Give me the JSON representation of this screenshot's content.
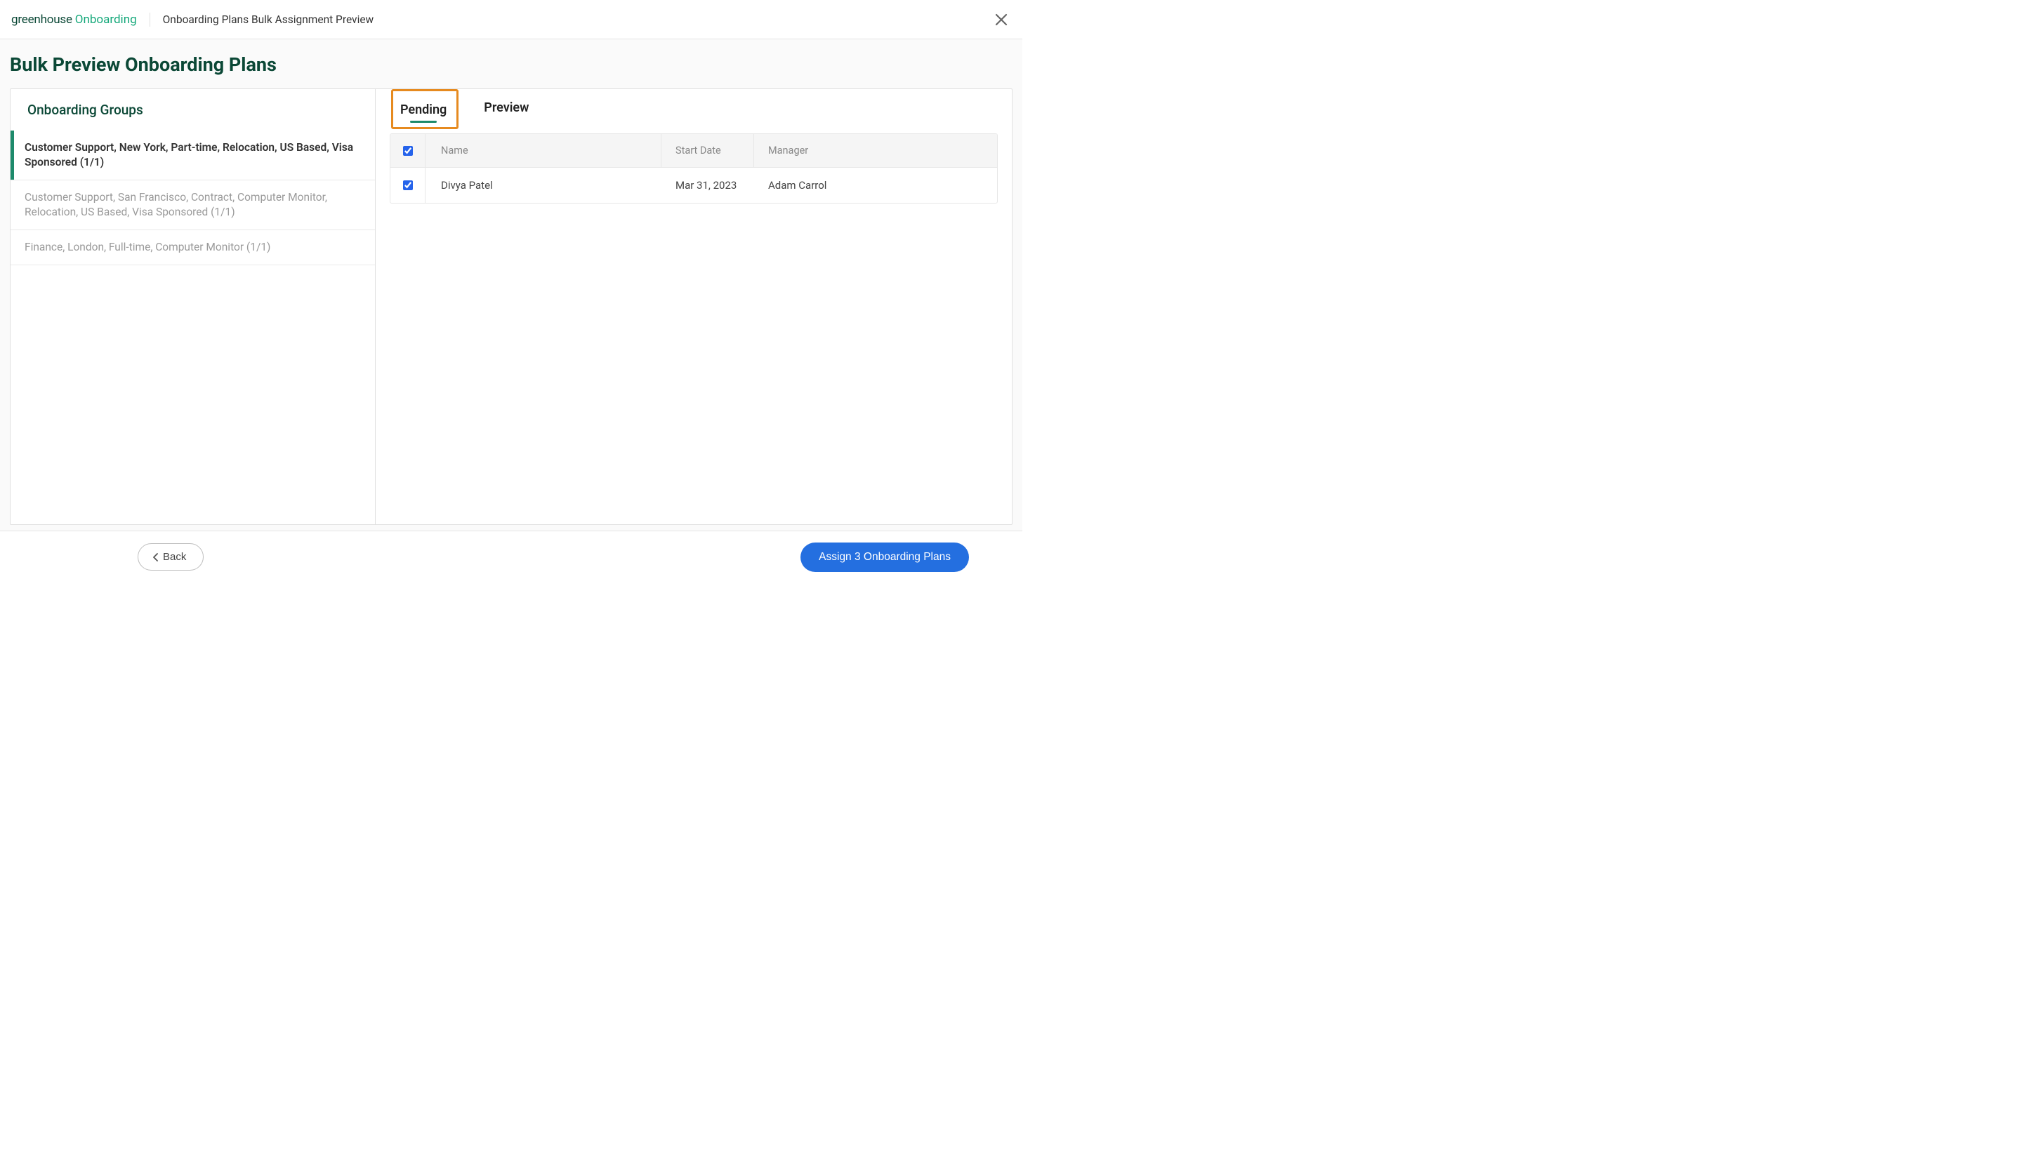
{
  "header": {
    "logo_primary": "greenhouse",
    "logo_secondary": "Onboarding",
    "breadcrumb": "Onboarding Plans Bulk Assignment Preview"
  },
  "page": {
    "title": "Bulk Preview Onboarding Plans"
  },
  "sidebar": {
    "title": "Onboarding Groups",
    "groups": [
      {
        "label": "Customer Support, New York, Part-time, Relocation, US Based, Visa Sponsored (1/1)",
        "active": true
      },
      {
        "label": "Customer Support, San Francisco, Contract, Computer Monitor, Relocation, US Based, Visa Sponsored (1/1)",
        "active": false
      },
      {
        "label": "Finance, London, Full-time, Computer Monitor (1/1)",
        "active": false
      }
    ]
  },
  "tabs": {
    "pending": "Pending",
    "preview": "Preview"
  },
  "table": {
    "headers": {
      "name": "Name",
      "start_date": "Start Date",
      "manager": "Manager"
    },
    "rows": [
      {
        "checked": true,
        "name": "Divya Patel",
        "start_date": "Mar 31, 2023",
        "manager": "Adam Carrol"
      }
    ]
  },
  "footer": {
    "back": "Back",
    "assign": "Assign 3 Onboarding Plans"
  }
}
